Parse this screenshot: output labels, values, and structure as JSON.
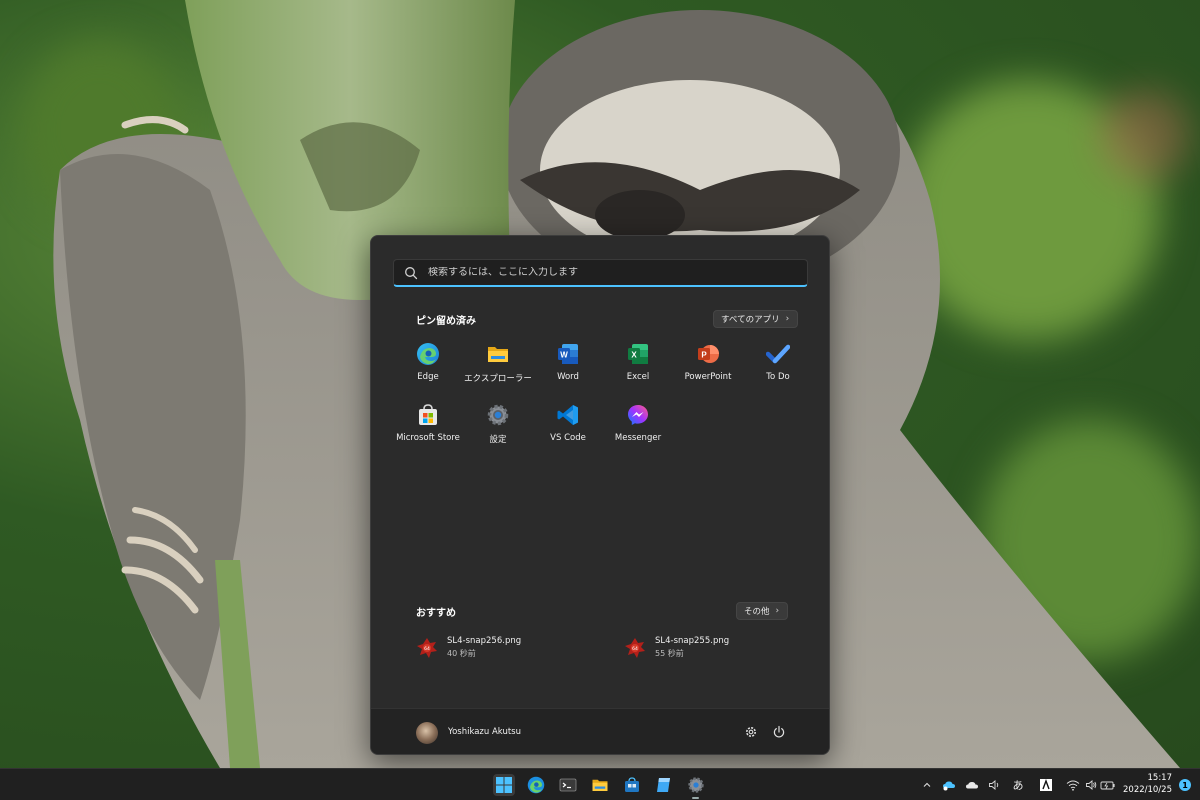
{
  "search": {
    "placeholder": "検索するには、ここに入力します"
  },
  "pinned": {
    "title": "ピン留め済み",
    "all_apps_label": "すべてのアプリ",
    "apps": [
      {
        "label": "Edge",
        "icon": "edge-icon"
      },
      {
        "label": "エクスプローラー",
        "icon": "file-explorer-icon"
      },
      {
        "label": "Word",
        "icon": "word-icon"
      },
      {
        "label": "Excel",
        "icon": "excel-icon"
      },
      {
        "label": "PowerPoint",
        "icon": "powerpoint-icon"
      },
      {
        "label": "To Do",
        "icon": "todo-icon"
      },
      {
        "label": "Microsoft Store",
        "icon": "store-icon"
      },
      {
        "label": "設定",
        "icon": "settings-icon"
      },
      {
        "label": "VS Code",
        "icon": "vscode-icon"
      },
      {
        "label": "Messenger",
        "icon": "messenger-icon"
      }
    ]
  },
  "recommended": {
    "title": "おすすめ",
    "more_label": "その他",
    "items": [
      {
        "name": "SL4-snap256.png",
        "time": "40 秒前"
      },
      {
        "name": "SL4-snap255.png",
        "time": "55 秒前"
      }
    ]
  },
  "user": {
    "name": "Yoshikazu Akutsu"
  },
  "taskbar": {
    "ime": "あ",
    "clock_time": "15:17",
    "clock_date": "2022/10/25",
    "notification_count": "1"
  },
  "colors": {
    "accent": "#4cc2ff",
    "menu_bg": "#2b2b2b",
    "taskbar_bg": "#202020"
  }
}
